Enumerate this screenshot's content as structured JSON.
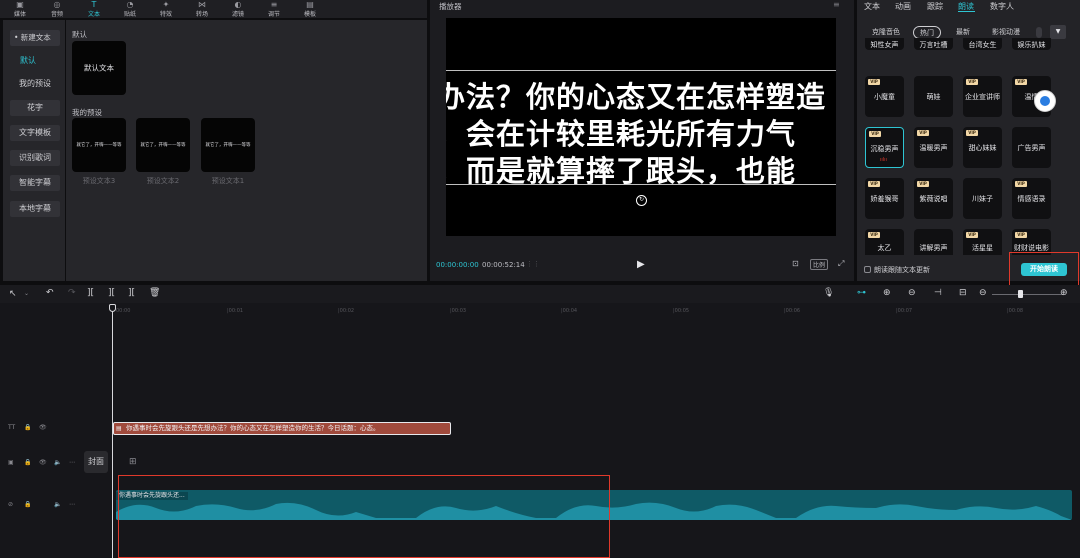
{
  "toolbar": {
    "items": [
      {
        "label": "媒体",
        "icon": "media-icon"
      },
      {
        "label": "音频",
        "icon": "audio-icon"
      },
      {
        "label": "文本",
        "icon": "text-icon",
        "active": true
      },
      {
        "label": "贴纸",
        "icon": "sticker-icon"
      },
      {
        "label": "特效",
        "icon": "effects-icon"
      },
      {
        "label": "转场",
        "icon": "transition-icon"
      },
      {
        "label": "滤镜",
        "icon": "filter-icon"
      },
      {
        "label": "调节",
        "icon": "adjust-icon"
      },
      {
        "label": "模板",
        "icon": "template-icon"
      }
    ]
  },
  "leftnav": {
    "new_text": "• 新建文本",
    "items": [
      "默认",
      "我的预设",
      "花字",
      "文字模板",
      "识别歌词",
      "智能字幕",
      "本地字幕"
    ]
  },
  "library": {
    "default_section": "默认",
    "default_card": "默认文本",
    "preset_section": "我的预设",
    "preset_card_text": "就它了，开嗨——等等",
    "presets": [
      "预设文本3",
      "预设文本2",
      "预设文本1"
    ]
  },
  "player": {
    "title": "播放器",
    "subtitle_lines": [
      "办法？你的心态又在怎样塑造",
      "，会在计较里耗光所有力气",
      "，而是就算摔了跟头，也能"
    ],
    "current_time": "00:00:00:00",
    "total_time": "00:00:52:14",
    "ratio_label": "比例"
  },
  "rightpanel": {
    "tabs": [
      "文本",
      "动画",
      "跟踪",
      "朗读",
      "数字人"
    ],
    "active_tab": "朗读",
    "chips": [
      "克隆音色",
      "热门",
      "最新",
      "影视动漫"
    ],
    "active_chip": "热门",
    "top_row": [
      "知性女声",
      "万言吐槽",
      "台湾女生",
      "娱乐扒妹"
    ],
    "voices": [
      {
        "name": "小魔童",
        "vip": true
      },
      {
        "name": "萌娃",
        "vip": false
      },
      {
        "name": "企业宣讲师",
        "vip": true
      },
      {
        "name": "温情",
        "vip": true
      },
      {
        "name": "沉稳男声",
        "vip": true,
        "selected": true
      },
      {
        "name": "温暖男声",
        "vip": true
      },
      {
        "name": "甜心妹妹",
        "vip": true
      },
      {
        "name": "广告男声",
        "vip": false
      },
      {
        "name": "娇羞猴哥",
        "vip": true
      },
      {
        "name": "紫薇说唱",
        "vip": true
      },
      {
        "name": "川妹子",
        "vip": false
      },
      {
        "name": "情感语录",
        "vip": true
      },
      {
        "name": "太乙",
        "vip": true
      },
      {
        "name": "讲解男声",
        "vip": false
      },
      {
        "name": "活星星",
        "vip": true
      },
      {
        "name": "财财说电影",
        "vip": true
      }
    ],
    "vip_badge": "VIP",
    "checkbox_label": "朗读跟随文本更新",
    "start_button": "开始朗读"
  },
  "timeline": {
    "ticks": [
      "00:00",
      "|00:01",
      "|00:02",
      "|00:03",
      "|00:04",
      "|00:05",
      "|00:06",
      "|00:07",
      "|00:08"
    ],
    "text_clip": "你遇事时会先旋跟头还是先想办法？你的心态又在怎样塑造你的生活？今日话题：心态。",
    "cover_label": "封面",
    "audio_clip": "你遇事时会先旋跟头还..."
  },
  "colors": {
    "accent": "#2ec5d3",
    "highlight_box": "#e0392b",
    "text_clip": "#a04a3c",
    "audio_clip": "#0f5a66",
    "waveform": "#1f8fa3"
  }
}
